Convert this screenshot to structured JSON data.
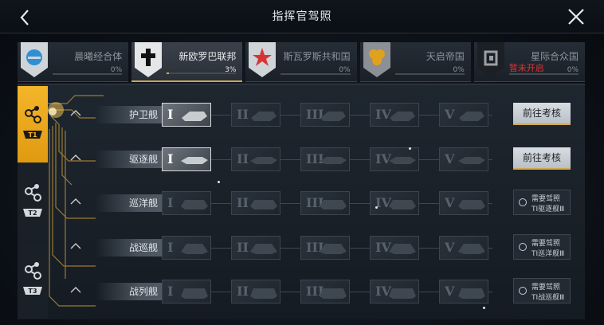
{
  "header": {
    "title": "指挥官驾照"
  },
  "factions": [
    {
      "name": "晨曦经合体",
      "pct": "0%",
      "fill": 0,
      "color": "#3a9ad9"
    },
    {
      "name": "新欧罗巴联邦",
      "pct": "3%",
      "fill": 0.03,
      "color": "#222222"
    },
    {
      "name": "斯瓦罗斯共和国",
      "pct": "0%",
      "fill": 0,
      "color": "#d83a3a"
    },
    {
      "name": "天启帝国",
      "pct": "0%",
      "fill": 0,
      "color": "#e0a020"
    },
    {
      "name": "星际合众国",
      "pct": "0%",
      "fill": 0,
      "color": "#3a3f45",
      "locked_text": "暂未开启"
    }
  ],
  "tiers": [
    {
      "label": "T1",
      "active": true
    },
    {
      "label": "T2",
      "active": false
    },
    {
      "label": "T3",
      "active": false
    }
  ],
  "ranks": [
    "I",
    "II",
    "III",
    "IV",
    "V"
  ],
  "rows": [
    {
      "label": "护卫舰",
      "unlocked_rank": 1,
      "action": "前往考核"
    },
    {
      "label": "驱逐舰",
      "unlocked_rank": 1,
      "action": "前往考核"
    },
    {
      "label": "巡洋舰",
      "unlocked_rank": 0,
      "req_line1": "需要驾照",
      "req_line2": "TI驱逐舰Ⅲ"
    },
    {
      "label": "战巡舰",
      "unlocked_rank": 0,
      "req_line1": "需要驾照",
      "req_line2": "TI巡洋舰Ⅲ"
    },
    {
      "label": "战列舰",
      "unlocked_rank": 0,
      "req_line1": "需要驾照",
      "req_line2": "TI战巡舰Ⅲ"
    }
  ]
}
